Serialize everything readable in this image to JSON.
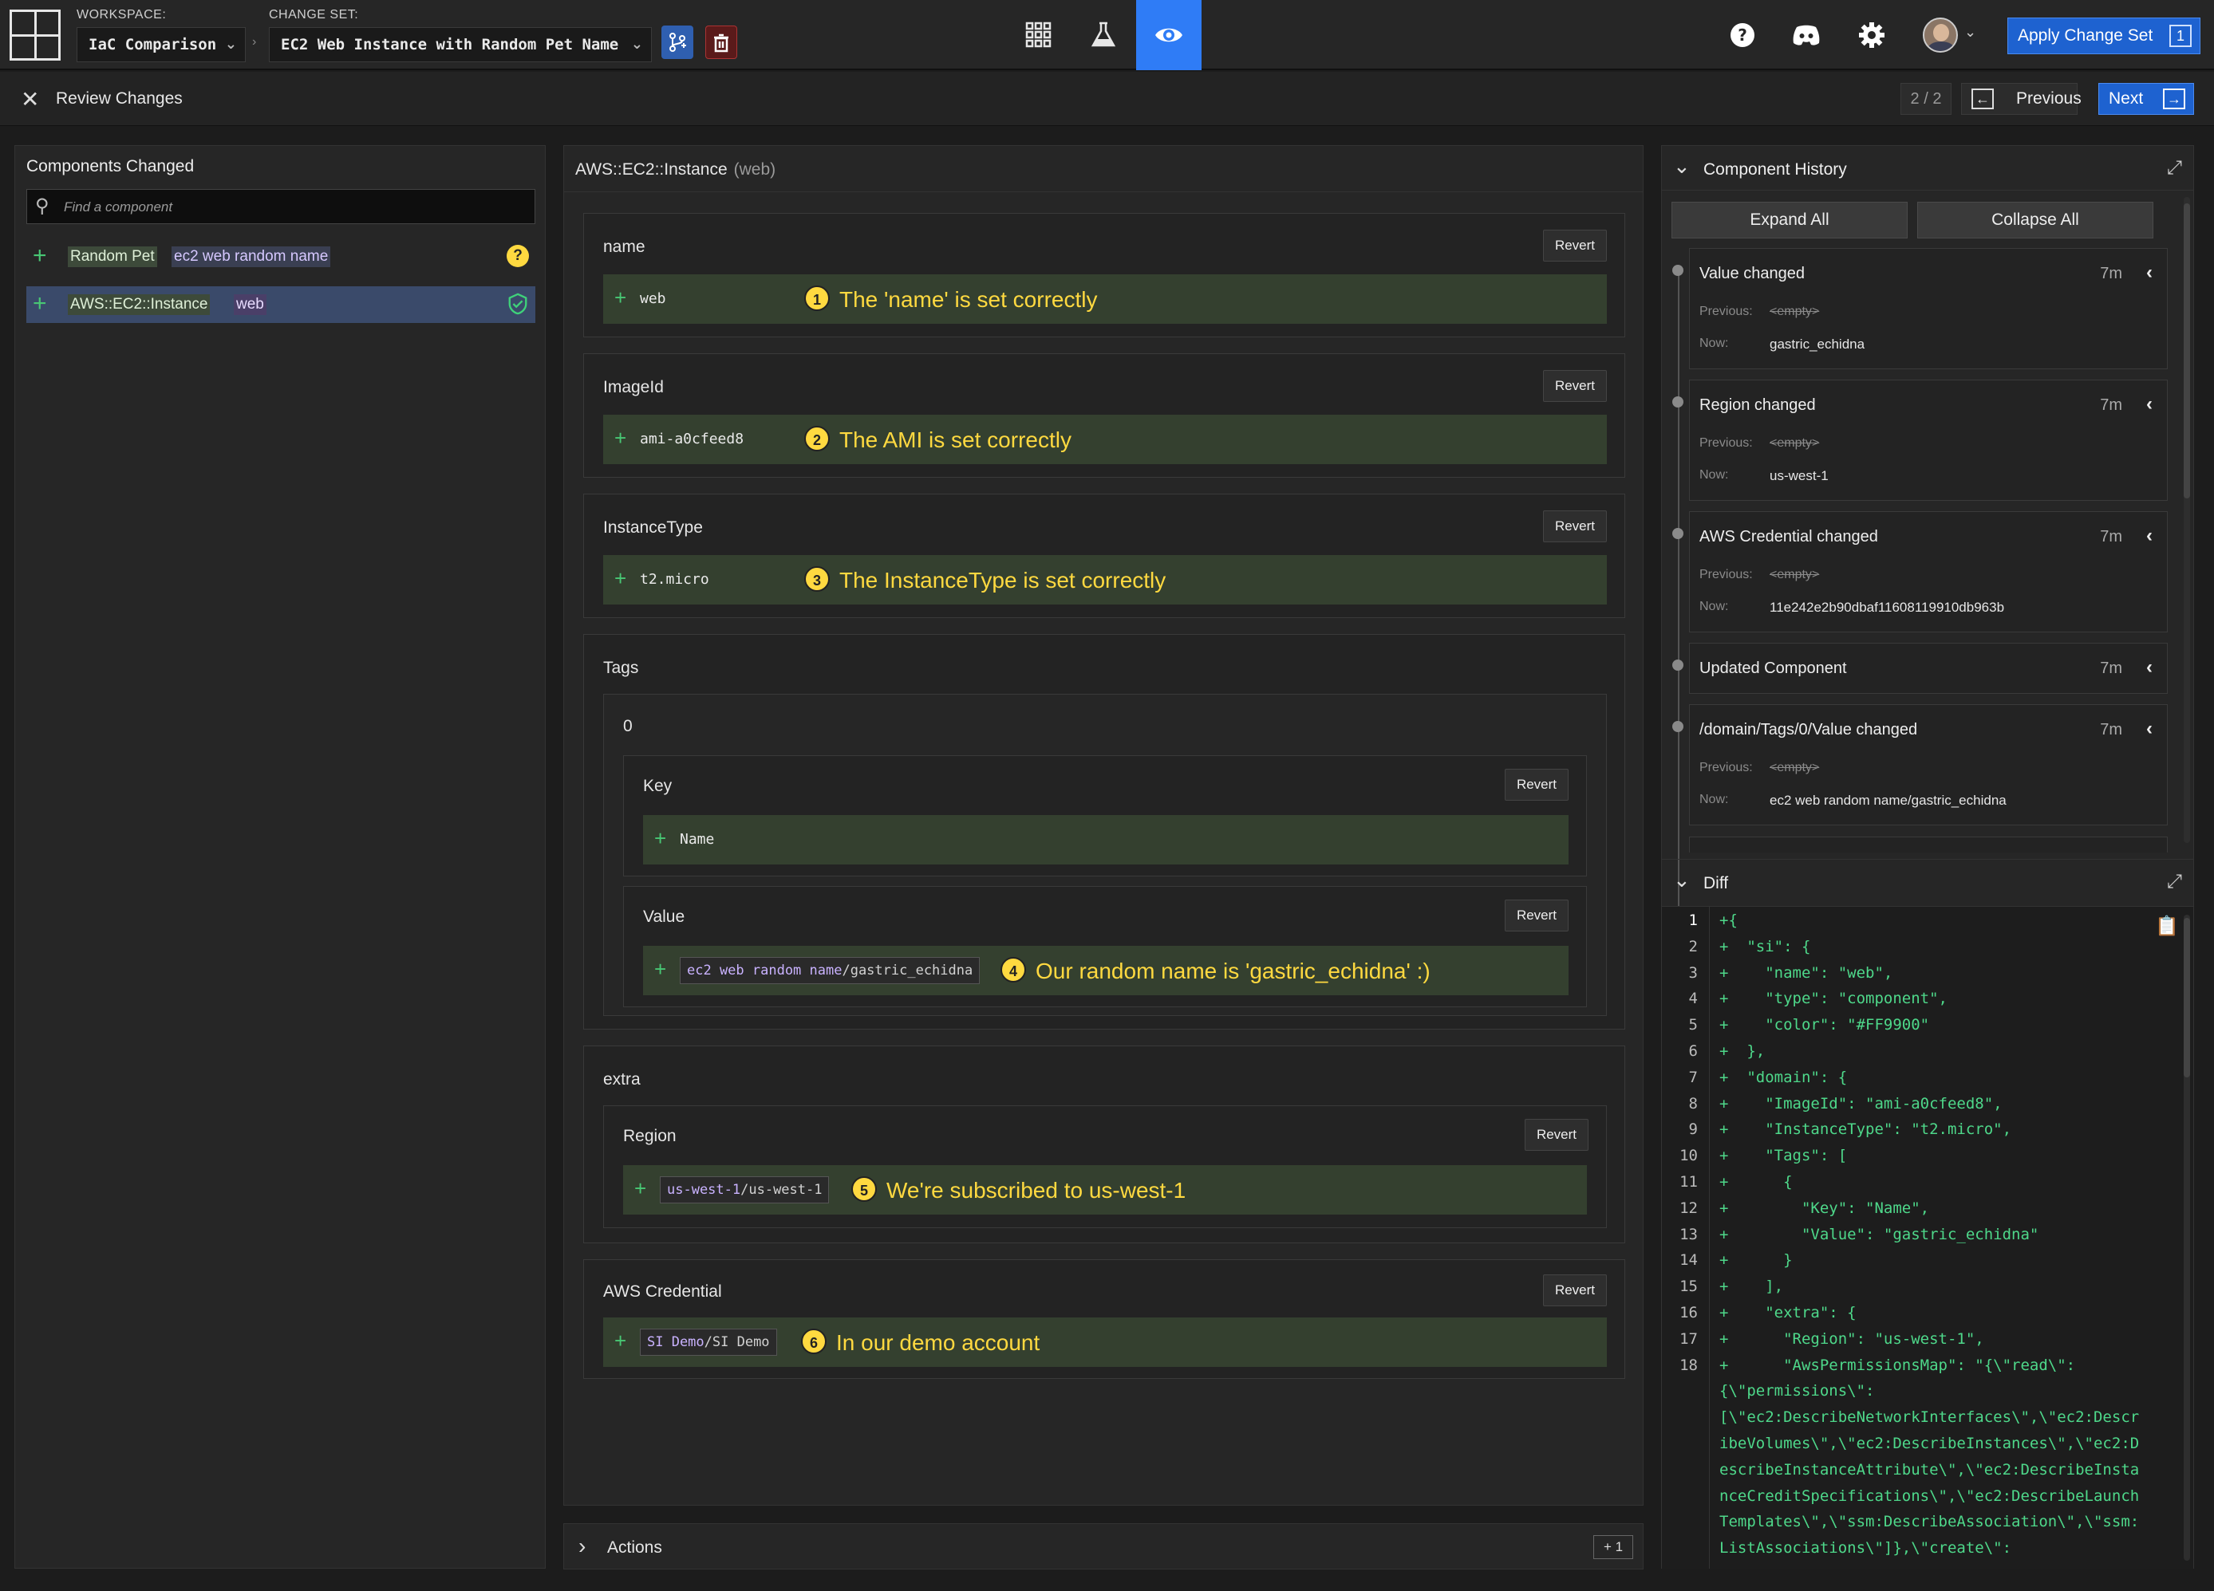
{
  "topbar": {
    "workspace_label": "WORKSPACE:",
    "workspace_value": "IaC Comparison",
    "changeset_label": "CHANGE SET:",
    "changeset_value": "EC2 Web Instance with Random Pet Name",
    "apply_label": "Apply Change Set",
    "apply_count": "1",
    "colors": {
      "accent": "#2f7cf6",
      "apply": "#1e62d0"
    },
    "icons": [
      "branch-icon",
      "trash-icon",
      "grid-icon",
      "flask-icon",
      "eye-icon",
      "help-icon",
      "discord-icon",
      "gear-icon",
      "avatar"
    ]
  },
  "subbar": {
    "title": "Review Changes",
    "pager": "2 / 2",
    "previous": "Previous",
    "next": "Next"
  },
  "left": {
    "title": "Components Changed",
    "search_placeholder": "Find a component",
    "components": [
      {
        "kind": "Random Pet",
        "name": "ec2 web random name",
        "status": "?",
        "selected": false
      },
      {
        "kind": "AWS::EC2::Instance",
        "name": "web",
        "status": "check",
        "selected": true
      }
    ]
  },
  "center": {
    "title": "AWS::EC2::Instance",
    "subtitle": "(web)",
    "revert": "Revert",
    "sections": {
      "name": {
        "title": "name",
        "value": "web",
        "badge": "1",
        "note": "The 'name' is set correctly"
      },
      "imageid": {
        "title": "ImageId",
        "value": "ami-a0cfeed8",
        "badge": "2",
        "note": "The AMI is set correctly"
      },
      "instancetype": {
        "title": "InstanceType",
        "value": "t2.micro",
        "badge": "3",
        "note": "The InstanceType is set correctly"
      },
      "tags": {
        "title": "Tags",
        "index": "0",
        "key_title": "Key",
        "key_value": "Name",
        "value_title": "Value",
        "value_chip_a": "ec2 web random name",
        "value_chip_b": "/gastric_echidna",
        "badge": "4",
        "note": "Our random name is 'gastric_echidna' :)"
      },
      "extra": {
        "title": "extra",
        "region_title": "Region",
        "chip_a": "us-west-1",
        "chip_b": "/us-west-1",
        "badge": "5",
        "note": "We're subscribed to us-west-1"
      },
      "credential": {
        "title": "AWS Credential",
        "chip_a": "SI Demo",
        "chip_b": "/SI Demo",
        "badge": "6",
        "note": "In our demo account"
      }
    },
    "actions": {
      "title": "Actions",
      "count": "+ 1"
    }
  },
  "right": {
    "history_title": "Component History",
    "expand_all": "Expand All",
    "collapse_all": "Collapse All",
    "previous_label": "Previous:",
    "now_label": "Now:",
    "empty": "<empty>",
    "entries": [
      {
        "title": "Value changed",
        "age": "7m",
        "now": "gastric_echidna"
      },
      {
        "title": "Region changed",
        "age": "7m",
        "now": "us-west-1"
      },
      {
        "title": "AWS Credential changed",
        "age": "7m",
        "now": "11e242e2b90dbaf11608119910db963b"
      },
      {
        "title": "Updated Component",
        "age": "7m"
      },
      {
        "title": "/domain/Tags/0/Value changed",
        "age": "7m",
        "now": "ec2 web random name/gastric_echidna"
      }
    ],
    "diff_title": "Diff",
    "diff_line_numbers": [
      "1",
      "2",
      "3",
      "4",
      "5",
      "6",
      "7",
      "8",
      "9",
      "10",
      "11",
      "12",
      "13",
      "14",
      "15",
      "16",
      "17",
      "18"
    ],
    "diff_lines": [
      "+{",
      "+  \"si\": {",
      "+    \"name\": \"web\",",
      "+    \"type\": \"component\",",
      "+    \"color\": \"#FF9900\"",
      "+  },",
      "+  \"domain\": {",
      "+    \"ImageId\": \"ami-a0cfeed8\",",
      "+    \"InstanceType\": \"t2.micro\",",
      "+    \"Tags\": [",
      "+      {",
      "+        \"Key\": \"Name\",",
      "+        \"Value\": \"gastric_echidna\"",
      "+      }",
      "+    ],",
      "+    \"extra\": {",
      "+      \"Region\": \"us-west-1\",",
      "+      \"AwsPermissionsMap\": \"{\\\"read\\\":",
      "{\\\"permissions\\\":",
      "[\\\"ec2:DescribeNetworkInterfaces\\\",\\\"ec2:Descr",
      "ibeVolumes\\\",\\\"ec2:DescribeInstances\\\",\\\"ec2:D",
      "escribeInstanceAttribute\\\",\\\"ec2:DescribeInsta",
      "nceCreditSpecifications\\\",\\\"ec2:DescribeLaunch",
      "Templates\\\",\\\"ssm:DescribeAssociation\\\",\\\"ssm:",
      "ListAssociations\\\"]},\\\"create\\\":"
    ]
  }
}
